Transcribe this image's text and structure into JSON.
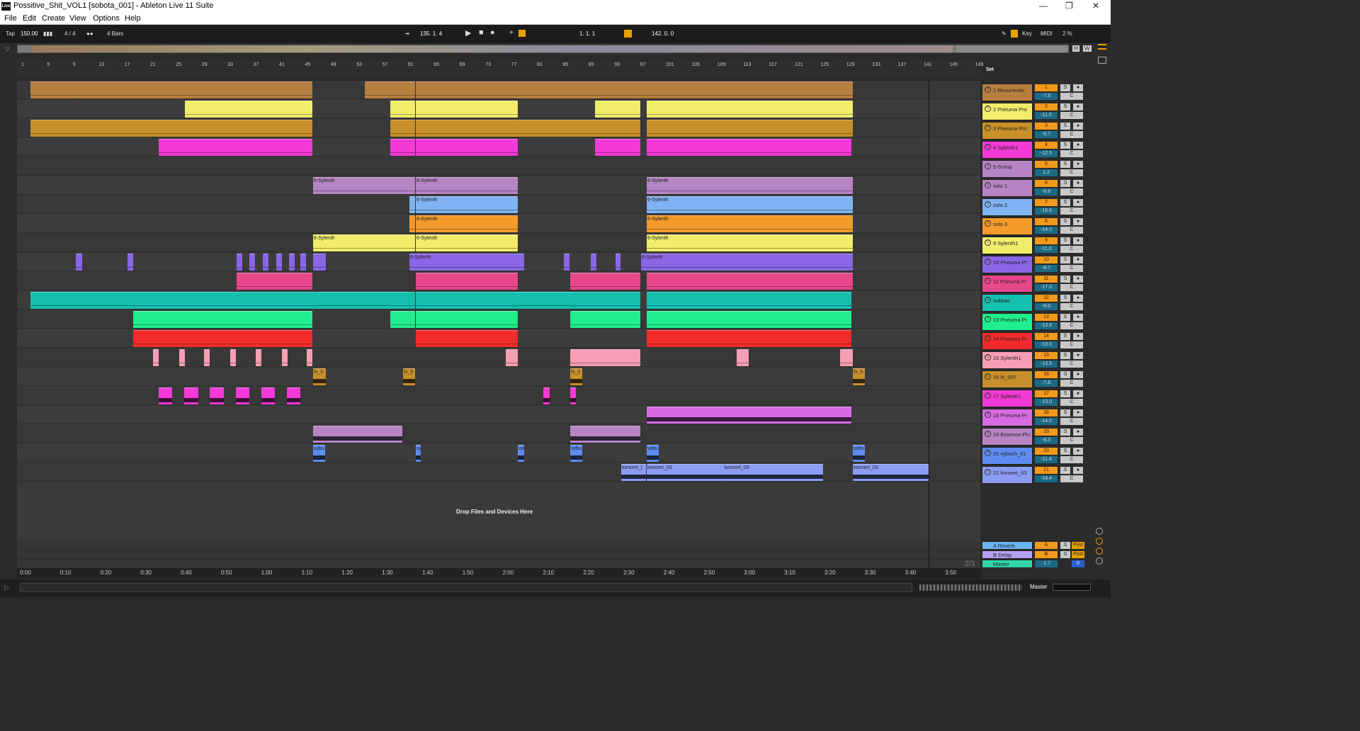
{
  "window": {
    "title": "Possitive_Shit_VOL1  [sobota_001] - Ableton Live 11 Suite",
    "logo": "Live",
    "minimize": "—",
    "maximize": "❐",
    "close": "✕"
  },
  "menu": [
    "File",
    "Edit",
    "Create",
    "View",
    "Options",
    "Help"
  ],
  "control": {
    "tap": "Tap",
    "tempo": "150.00",
    "meter": "4 / 4",
    "quant": "4 Bars",
    "position": "135.  1.  4",
    "loop_start": "1.  1.  1",
    "loop_len": "142.  0.  0",
    "key": "Key",
    "midi": "MIDI",
    "cpu": "2 %",
    "hw_h": "H",
    "hw_w": "W"
  },
  "ruler": [
    "1",
    "5",
    "9",
    "13",
    "17",
    "21",
    "25",
    "29",
    "33",
    "37",
    "41",
    "45",
    "49",
    "53",
    "57",
    "61",
    "65",
    "69",
    "73",
    "77",
    "81",
    "85",
    "89",
    "93",
    "97",
    "101",
    "105",
    "109",
    "113",
    "117",
    "121",
    "125",
    "129",
    "133",
    "137",
    "141",
    "145",
    "149"
  ],
  "timeline": [
    "0:00",
    "0:10",
    "0:20",
    "0:30",
    "0:40",
    "0:50",
    "1:00",
    "1:10",
    "1:20",
    "1:30",
    "1:40",
    "1:50",
    "2:00",
    "2:10",
    "2:20",
    "2:30",
    "2:40",
    "2:50",
    "3:00",
    "3:10",
    "3:20",
    "3:30",
    "3:40",
    "3:50"
  ],
  "set_label": "Set",
  "drop_hint": "Drop Files and Devices Here",
  "page_indicator": "2/1",
  "tracks": [
    {
      "name": "1 Resurrectio",
      "color": "#b77f3f",
      "num": "1",
      "vol": "-7.5",
      "fold": "▽"
    },
    {
      "name": "2 Pneuma Pro",
      "color": "#f1ec6a",
      "num": "2",
      "vol": "-11.0",
      "fold": "▽"
    },
    {
      "name": "3 Pneuma Pro",
      "color": "#c8902a",
      "num": "3",
      "vol": "-6.7",
      "fold": "▽"
    },
    {
      "name": "4 Sylenth1",
      "color": "#f33ad6",
      "num": "4",
      "vol": "-12.5",
      "fold": "▽"
    },
    {
      "name": "5 Group",
      "color": "#b784c4",
      "num": "5",
      "vol": "1.2",
      "fold": "◇"
    },
    {
      "name": "solo 1",
      "color": "#b784c4",
      "num": "6",
      "vol": "-8.6",
      "fold": "▽"
    },
    {
      "name": "solo 2",
      "color": "#7fb3f4",
      "num": "7",
      "vol": "-15.6",
      "fold": "▽"
    },
    {
      "name": "solo 3",
      "color": "#f39a2a",
      "num": "8",
      "vol": "-14.0",
      "fold": "▽"
    },
    {
      "name": "9 Sylenth1",
      "color": "#f1ec6a",
      "num": "9",
      "vol": "-11.0",
      "fold": "▽"
    },
    {
      "name": "10 Pneuma Pr",
      "color": "#8a66e6",
      "num": "10",
      "vol": "-8.7",
      "fold": "▽"
    },
    {
      "name": "11 Pneuma Pr",
      "color": "#e9478c",
      "num": "11",
      "vol": "-17.0",
      "fold": "▽"
    },
    {
      "name": "subbas",
      "color": "#14bfae",
      "num": "12",
      "vol": "-8.0",
      "fold": "▽"
    },
    {
      "name": "13 Pneuma Pr",
      "color": "#21ee8c",
      "num": "13",
      "vol": "-13.8",
      "fold": "▽"
    },
    {
      "name": "14 Pneuma Pr",
      "color": "#f42b2b",
      "num": "14",
      "vol": "-13.0",
      "fold": "▽"
    },
    {
      "name": "15 Sylenth1",
      "color": "#f79db5",
      "num": "15",
      "vol": "-13.5",
      "fold": "▽"
    },
    {
      "name": "16 fx_007",
      "color": "#c8902a",
      "num": "16",
      "vol": "-7.8",
      "fold": "▽"
    },
    {
      "name": "17 Sylenth1",
      "color": "#f33ad6",
      "num": "17",
      "vol": "-13.0",
      "fold": "▽"
    },
    {
      "name": "18 Pneuma Pr",
      "color": "#d86be2",
      "num": "18",
      "vol": "-14.0",
      "fold": "▽"
    },
    {
      "name": "19 Essence Plu",
      "color": "#b784c4",
      "num": "19",
      "vol": "-8.3",
      "fold": "▽"
    },
    {
      "name": "20 vybuch_01",
      "color": "#5f8cf0",
      "num": "20",
      "vol": "-11.4",
      "fold": "▽"
    },
    {
      "name": "21 koncert_03",
      "color": "#8a9cf4",
      "num": "21",
      "vol": "-14.4",
      "fold": "▽"
    }
  ],
  "returns": [
    {
      "name": "A Reverb",
      "color": "#6ab4f4",
      "num": "A",
      "send": "Post"
    },
    {
      "name": "B Delay",
      "color": "#b5a0f0",
      "num": "B",
      "send": "Post"
    },
    {
      "name": "Master",
      "color": "#2fd6a8",
      "num": "-1.7",
      "send": "0"
    }
  ],
  "clip_label_sylenth": "6-Sylenth",
  "clip_label_fx": "fx_0",
  "clip_label_vyb": "vybu",
  "clip_label_koncert": "koncert_03",
  "clip_label_koncert_short": "koncert_(",
  "master_label": "Master"
}
